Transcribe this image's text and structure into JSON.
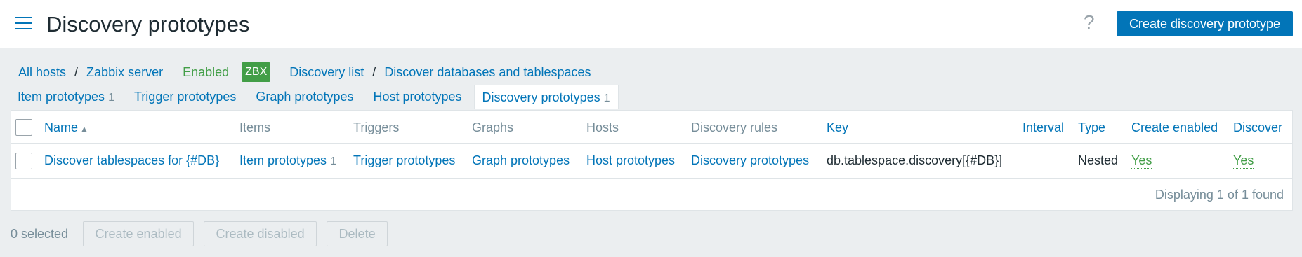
{
  "header": {
    "title": "Discovery prototypes",
    "help_icon": "?",
    "create_button": "Create discovery prototype"
  },
  "breadcrumbs": {
    "all_hosts": "All hosts",
    "host": "Zabbix server",
    "status": "Enabled",
    "badge": "ZBX",
    "discovery_list": "Discovery list",
    "rule": "Discover databases and tablespaces",
    "separator": "/"
  },
  "tabs": [
    {
      "label": "Item prototypes",
      "count": "1"
    },
    {
      "label": "Trigger prototypes",
      "count": ""
    },
    {
      "label": "Graph prototypes",
      "count": ""
    },
    {
      "label": "Host prototypes",
      "count": ""
    },
    {
      "label": "Discovery prototypes",
      "count": "1"
    }
  ],
  "table": {
    "columns": {
      "name": "Name",
      "items": "Items",
      "triggers": "Triggers",
      "graphs": "Graphs",
      "hosts": "Hosts",
      "discovery_rules": "Discovery rules",
      "key": "Key",
      "interval": "Interval",
      "type": "Type",
      "create_enabled": "Create enabled",
      "discover": "Discover"
    },
    "rows": [
      {
        "name": "Discover tablespaces for {#DB}",
        "items": "Item prototypes",
        "items_count": "1",
        "triggers": "Trigger prototypes",
        "graphs": "Graph prototypes",
        "hosts": "Host prototypes",
        "discovery_rules": "Discovery prototypes",
        "key": "db.tablespace.discovery[{#DB}]",
        "interval": "",
        "type": "Nested",
        "create_enabled": "Yes",
        "discover": "Yes"
      }
    ],
    "footer": "Displaying 1 of 1 found"
  },
  "actions": {
    "selected": "0 selected",
    "create_enabled": "Create enabled",
    "create_disabled": "Create disabled",
    "delete": "Delete"
  }
}
